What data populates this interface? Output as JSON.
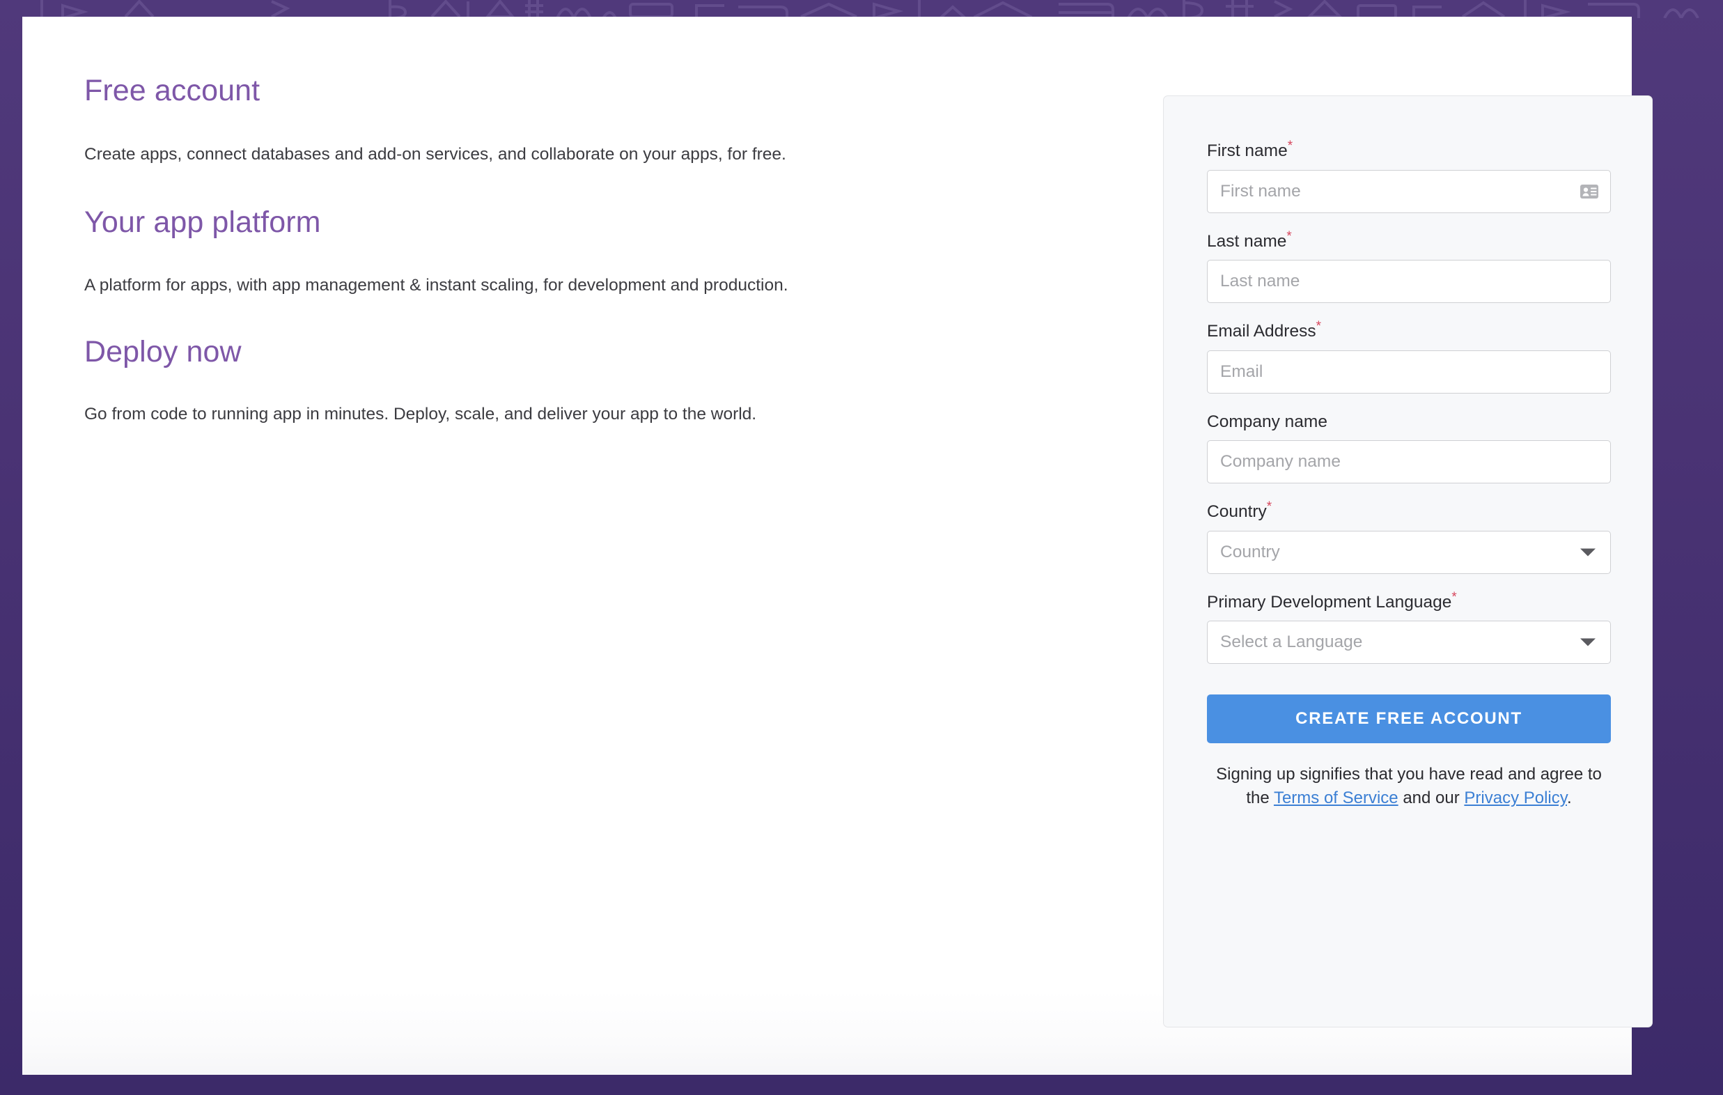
{
  "theme": {
    "background_purple": "#50397b",
    "background_purple_dark": "#3c2a69",
    "heading_purple": "#7e57a8",
    "body_text": "#3c3c41",
    "card_background": "#f7f8fa",
    "card_border": "#e4e5e8",
    "input_border": "#cfd0d3",
    "placeholder_gray": "#a4a5a9",
    "required_red": "#d6455b",
    "button_blue": "#4a90e2",
    "link_blue": "#3b7fd4"
  },
  "left_column": {
    "sections": [
      {
        "heading": "Free account",
        "body": "Create apps, connect databases and add-on services, and collaborate on your apps, for free."
      },
      {
        "heading": "Your app platform",
        "body": "A platform for apps, with app management & instant scaling, for development and production."
      },
      {
        "heading": "Deploy now",
        "body": "Go from code to running app in minutes. Deploy, scale, and deliver your app to the world."
      }
    ]
  },
  "signup_form": {
    "fields": [
      {
        "label": "First name",
        "required": true,
        "required_marker": "*",
        "type": "text",
        "placeholder": "First name",
        "value": "",
        "trailing_icon": "contact-card-icon"
      },
      {
        "label": "Last name",
        "required": true,
        "required_marker": "*",
        "type": "text",
        "placeholder": "Last name",
        "value": "",
        "trailing_icon": ""
      },
      {
        "label": "Email Address",
        "required": true,
        "required_marker": "*",
        "type": "email",
        "placeholder": "Email",
        "value": "",
        "trailing_icon": ""
      },
      {
        "label": "Company name",
        "required": false,
        "required_marker": "",
        "type": "text",
        "placeholder": "Company name",
        "value": "",
        "trailing_icon": ""
      },
      {
        "label": "Country",
        "required": true,
        "required_marker": "*",
        "type": "select",
        "placeholder": "Country",
        "value": "",
        "trailing_icon": "chevron-down-icon"
      },
      {
        "label": "Primary Development Language",
        "required": true,
        "required_marker": "*",
        "type": "select",
        "placeholder": "Select a Language",
        "value": "",
        "trailing_icon": "chevron-down-icon"
      }
    ],
    "submit_label": "CREATE FREE ACCOUNT",
    "legal": {
      "text_before": "Signing up signifies that you have read and agree to the ",
      "terms_link": "Terms of Service",
      "text_middle": " and our ",
      "privacy_link": "Privacy Policy",
      "text_after": "."
    }
  }
}
